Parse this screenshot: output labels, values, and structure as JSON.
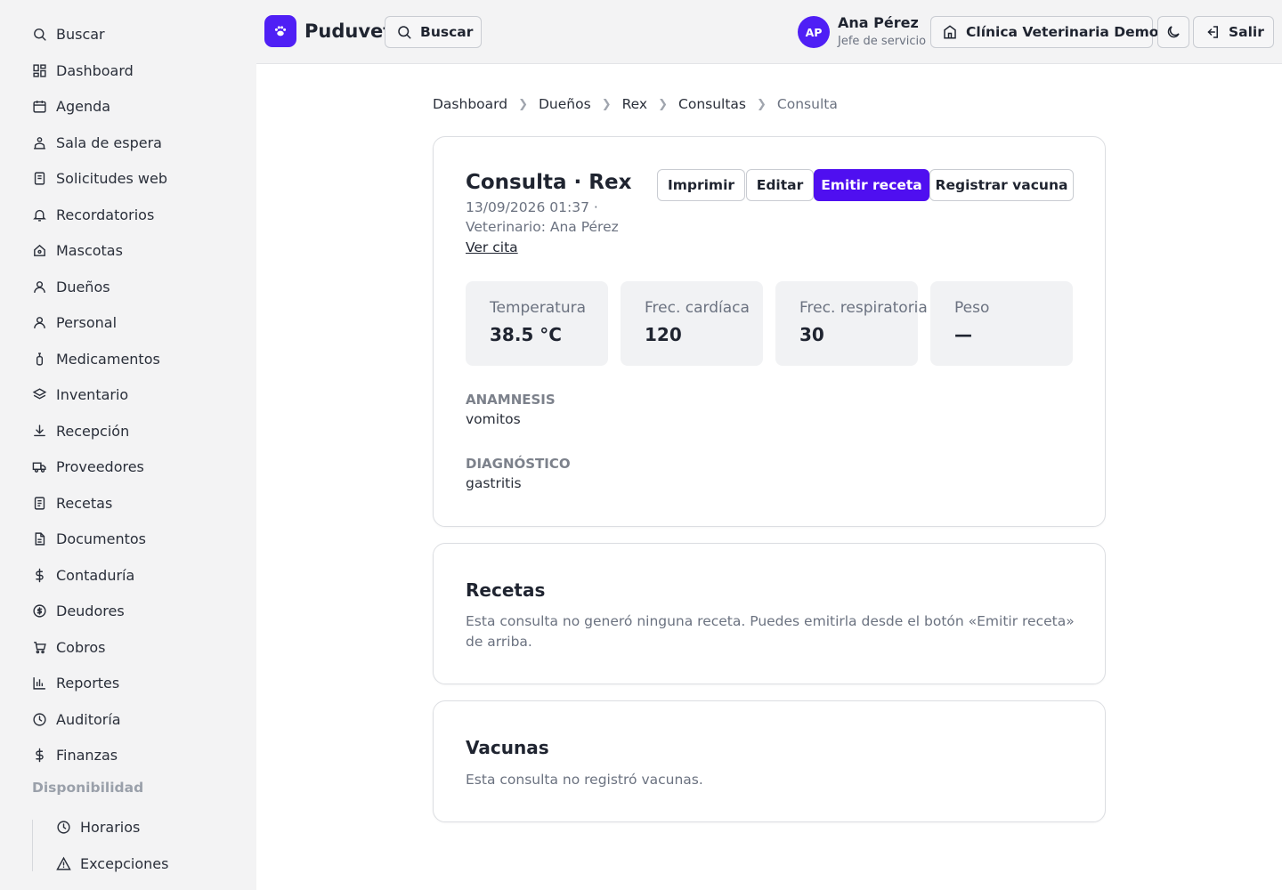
{
  "sidebar": {
    "items": [
      {
        "label": "Buscar",
        "icon": "search-icon"
      },
      {
        "label": "Dashboard",
        "icon": "dashboard-icon"
      },
      {
        "label": "Agenda",
        "icon": "calendar-icon"
      },
      {
        "label": "Sala de espera",
        "icon": "waiting-room-icon"
      },
      {
        "label": "Solicitudes web",
        "icon": "file-icon"
      },
      {
        "label": "Recordatorios",
        "icon": "bell-icon"
      },
      {
        "label": "Mascotas",
        "icon": "pet-icon"
      },
      {
        "label": "Dueños",
        "icon": "user-icon"
      },
      {
        "label": "Personal",
        "icon": "user-icon"
      },
      {
        "label": "Medicamentos",
        "icon": "medicine-icon"
      },
      {
        "label": "Inventario",
        "icon": "layers-icon"
      },
      {
        "label": "Recepción",
        "icon": "download-icon"
      },
      {
        "label": "Proveedores",
        "icon": "truck-icon"
      },
      {
        "label": "Recetas",
        "icon": "prescription-icon"
      },
      {
        "label": "Documentos",
        "icon": "document-icon"
      },
      {
        "label": "Contaduría",
        "icon": "dollar-icon"
      },
      {
        "label": "Deudores",
        "icon": "coin-icon"
      },
      {
        "label": "Cobros",
        "icon": "cart-icon"
      },
      {
        "label": "Reportes",
        "icon": "bar-chart-icon"
      },
      {
        "label": "Auditoría",
        "icon": "clock-icon"
      },
      {
        "label": "Finanzas",
        "icon": "dollar-icon"
      }
    ],
    "section_label": "Disponibilidad",
    "sub_items": [
      {
        "label": "Horarios",
        "icon": "clock-icon"
      },
      {
        "label": "Excepciones",
        "icon": "warning-icon"
      }
    ]
  },
  "header": {
    "brand": "Puduvet",
    "search_label": "Buscar",
    "user_initials": "AP",
    "user_name": "Ana Pérez",
    "user_role": "Jefe de servicio",
    "clinic_label": "Clínica Veterinaria Demo",
    "logout_label": "Salir"
  },
  "breadcrumb": [
    "Dashboard",
    "Dueños",
    "Rex",
    "Consultas",
    "Consulta"
  ],
  "consulta": {
    "title": "Consulta · Rex",
    "datetime": "13/09/2026 01:37 ·",
    "vet": "Veterinario: Ana Pérez",
    "ver_cita": "Ver cita",
    "actions": {
      "print": "Imprimir",
      "edit": "Editar",
      "emit": "Emitir receta",
      "vaccine": "Registrar vacuna"
    },
    "vitals": [
      {
        "label": "Temperatura",
        "value": "38.5 °C"
      },
      {
        "label": "Frec. cardíaca",
        "value": "120"
      },
      {
        "label": "Frec. respiratoria",
        "value": "30"
      },
      {
        "label": "Peso",
        "value": "—"
      }
    ],
    "anamnesis_label": "Anamnesis",
    "anamnesis": "vomitos",
    "diagnostico_label": "Diagnóstico",
    "diagnostico": "gastritis"
  },
  "recetas": {
    "title": "Recetas",
    "text": "Esta consulta no generó ninguna receta. Puedes emitirla desde el botón «Emitir receta» de arriba."
  },
  "vacunas": {
    "title": "Vacunas",
    "text": "Esta consulta no registró vacunas."
  },
  "colors": {
    "accent": "#4f0ff0",
    "sidebar_bg": "#f3f3f4"
  }
}
